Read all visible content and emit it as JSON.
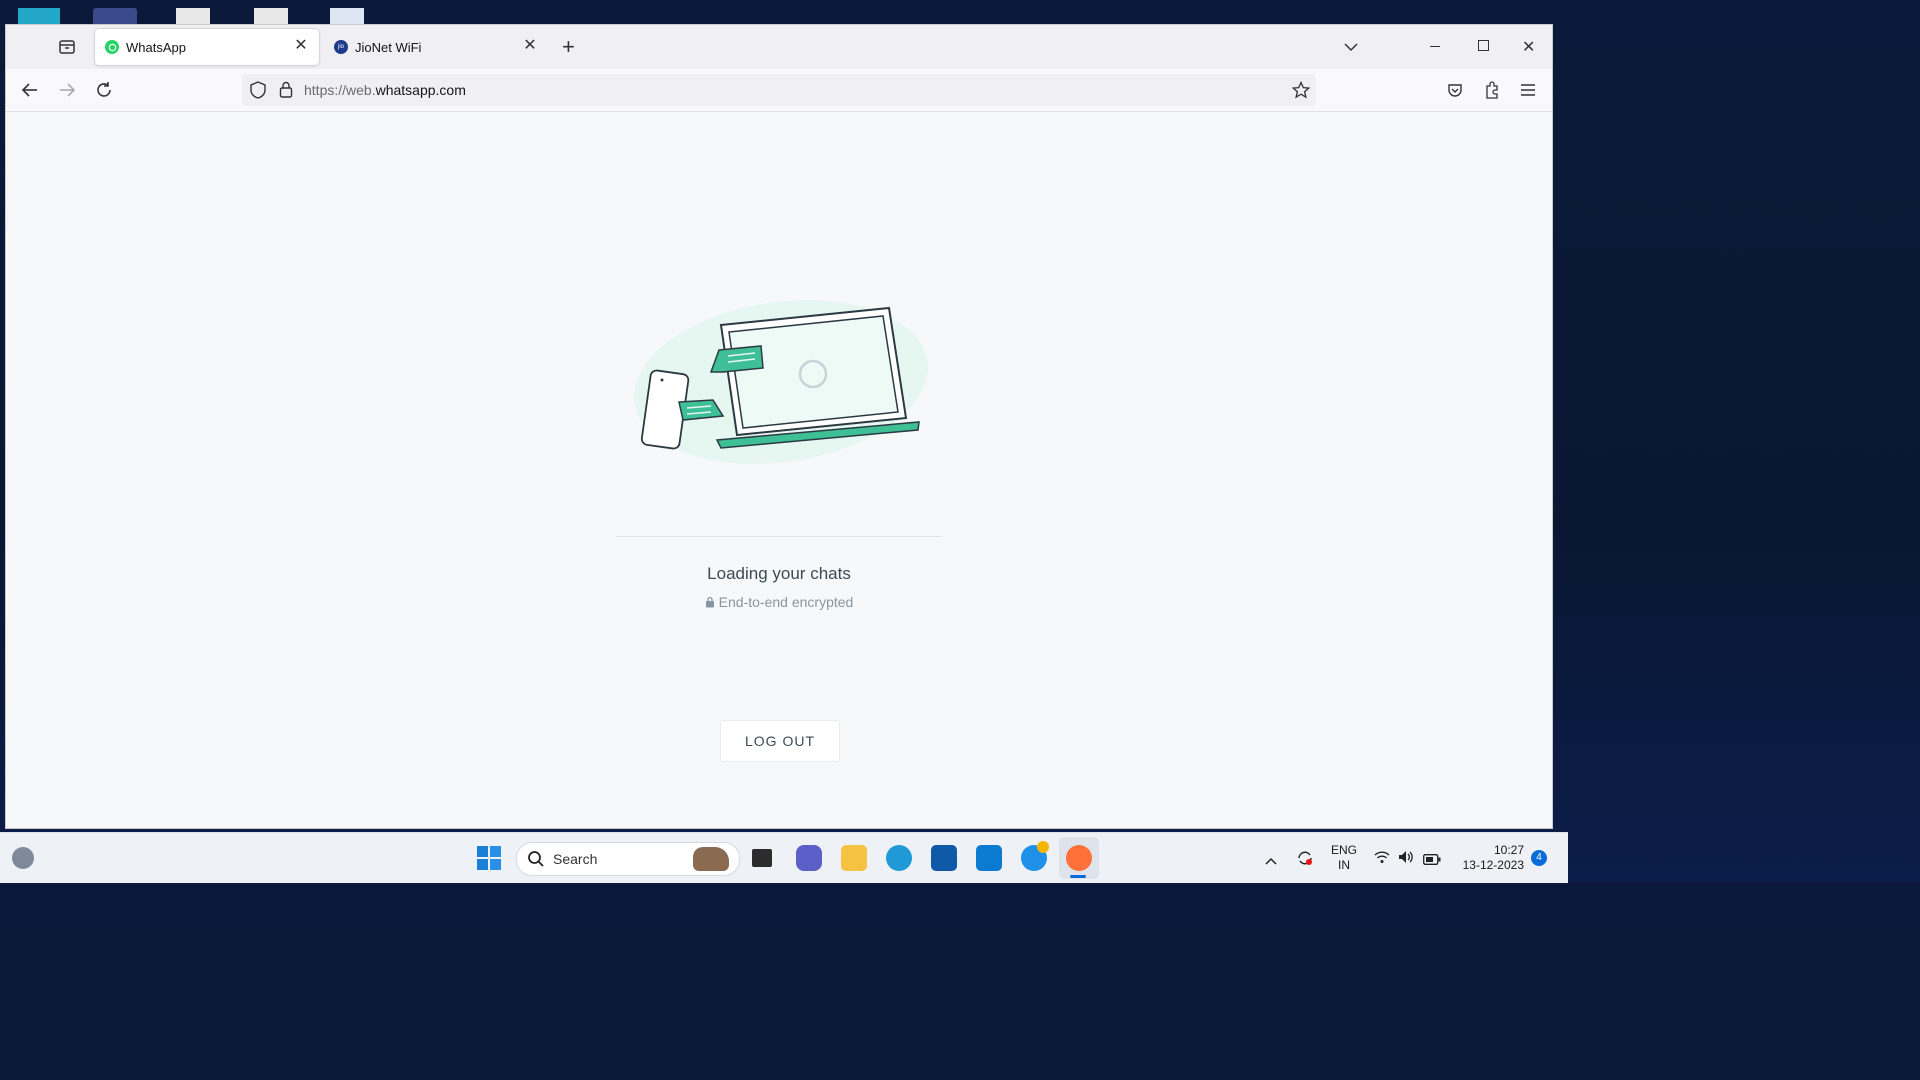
{
  "browser": {
    "tabs": [
      {
        "label": "WhatsApp",
        "active": true,
        "icon": "whatsapp-icon"
      },
      {
        "label": "JioNet WiFi",
        "active": false,
        "icon": "jio-icon"
      }
    ],
    "url": {
      "prefix": "https://web.",
      "domain": "whatsapp.com"
    }
  },
  "page": {
    "loading_title": "Loading your chats",
    "encryption_note": "End-to-end encrypted",
    "logout_label": "LOG OUT"
  },
  "taskbar": {
    "search_placeholder": "Search",
    "language": {
      "line1": "ENG",
      "line2": "IN"
    },
    "clock": {
      "time": "10:27",
      "date": "13-12-2023"
    },
    "notification_count": "4"
  },
  "colors": {
    "accent": "#25d366",
    "illustration_green": "#3fbf96",
    "illustration_bg": "#e6f6f1"
  }
}
